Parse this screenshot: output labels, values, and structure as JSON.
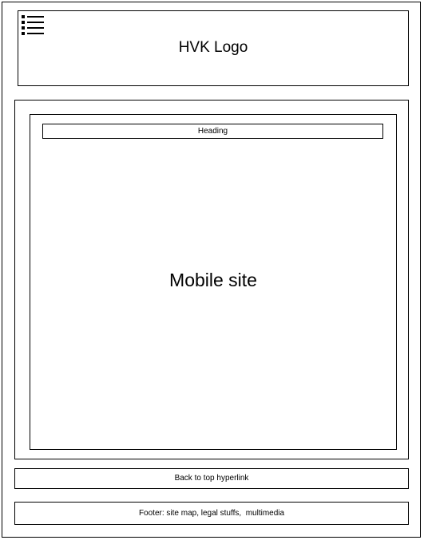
{
  "header": {
    "menu_icon": "hamburger-menu-icon",
    "logo_text": "HVK Logo"
  },
  "main": {
    "heading": "Heading",
    "body_label": "Mobile site"
  },
  "back_to_top": {
    "label": "Back to top hyperlink"
  },
  "footer": {
    "text": "Footer: site map, legal stuffs,  multimedia"
  }
}
